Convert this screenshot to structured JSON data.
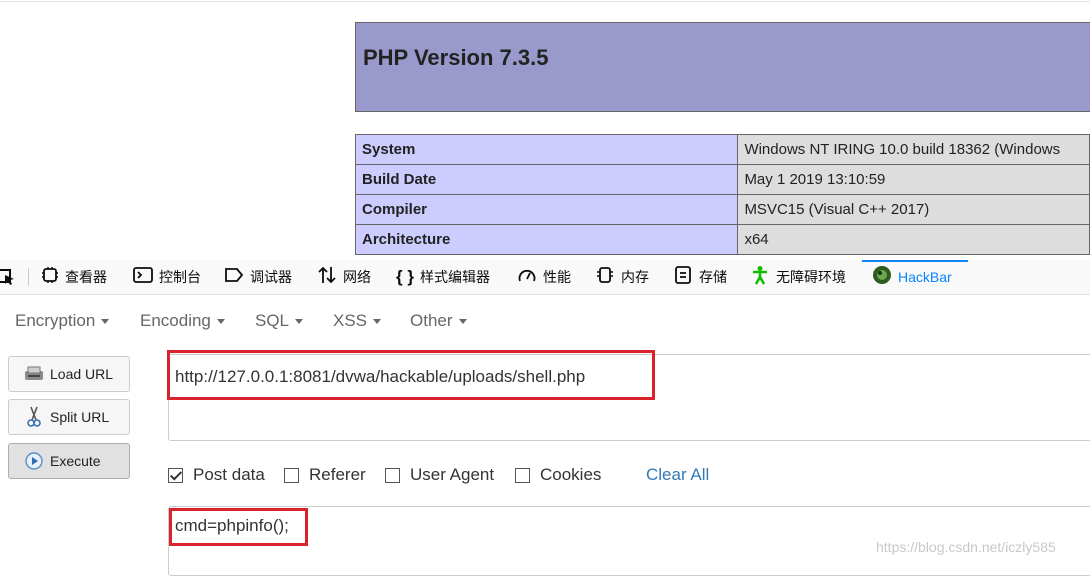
{
  "php": {
    "title": "PHP Version 7.3.5",
    "rows": [
      {
        "key": "System",
        "value": "Windows NT IRING 10.0 build 18362 (Windows"
      },
      {
        "key": "Build Date",
        "value": "May 1 2019 13:10:59"
      },
      {
        "key": "Compiler",
        "value": "MSVC15 (Visual C++ 2017)"
      },
      {
        "key": "Architecture",
        "value": "x64"
      }
    ]
  },
  "devtools": {
    "tabs": [
      {
        "label": "查看器",
        "icon": "inspector-icon"
      },
      {
        "label": "控制台",
        "icon": "console-icon"
      },
      {
        "label": "调试器",
        "icon": "debugger-icon"
      },
      {
        "label": "网络",
        "icon": "network-icon"
      },
      {
        "label": "样式编辑器",
        "icon": "style-editor-icon"
      },
      {
        "label": "性能",
        "icon": "performance-icon"
      },
      {
        "label": "内存",
        "icon": "memory-icon"
      },
      {
        "label": "存储",
        "icon": "storage-icon"
      },
      {
        "label": "无障碍环境",
        "icon": "accessibility-icon"
      },
      {
        "label": "HackBar",
        "icon": "hackbar-icon",
        "active": true
      }
    ]
  },
  "hackbar": {
    "menu": [
      "Encryption",
      "Encoding",
      "SQL",
      "XSS",
      "Other"
    ],
    "buttons": {
      "load": "Load URL",
      "split": "Split URL",
      "execute": "Execute"
    },
    "url": "http://127.0.0.1:8081/dvwa/hackable/uploads/shell.php",
    "options": [
      {
        "label": "Post data",
        "checked": true
      },
      {
        "label": "Referer",
        "checked": false
      },
      {
        "label": "User Agent",
        "checked": false
      },
      {
        "label": "Cookies",
        "checked": false
      }
    ],
    "clear_all": "Clear All",
    "post_data": "cmd=phpinfo();"
  },
  "watermark": "https://blog.csdn.net/iczly585",
  "colors": {
    "highlight": "#d9232d",
    "php_header": "#9999cc",
    "php_key": "#ccccff",
    "php_value": "#dddddd",
    "accent": "#0a84ff"
  }
}
